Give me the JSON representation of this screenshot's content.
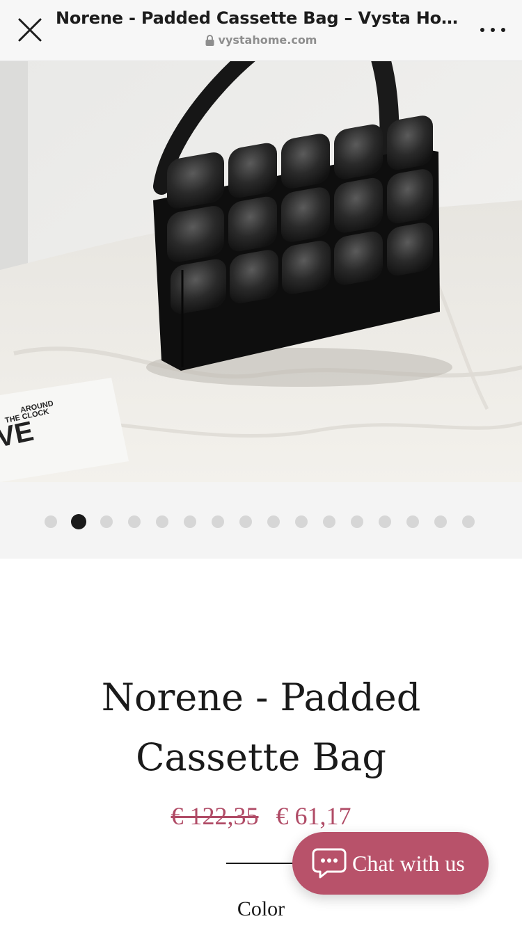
{
  "browser": {
    "page_title": "Norene - Padded Cassette Bag – Vysta Home",
    "url": "vystahome.com",
    "close_icon": "close-icon",
    "more_icon": "more-dots-icon",
    "lock_icon": "lock-icon"
  },
  "gallery": {
    "total_images": 16,
    "active_index": 1,
    "photo_props_text": [
      "AROUND",
      "THE CLOCK",
      "VE"
    ]
  },
  "product": {
    "name_line1": "Norene - Padded",
    "name_line2": "Cassette Bag",
    "old_price": "€ 122,35",
    "price": "€ 61,17",
    "option_label": "Color"
  },
  "chat": {
    "label": "Chat with us",
    "icon": "chat-bubble-icon"
  },
  "colors": {
    "accent": "#b8526a",
    "price": "#b04b66",
    "text": "#1a1a1a",
    "dot_inactive": "#d6d6d6",
    "dot_active": "#1a1a1a",
    "bar_bg": "#f7f7f7"
  }
}
